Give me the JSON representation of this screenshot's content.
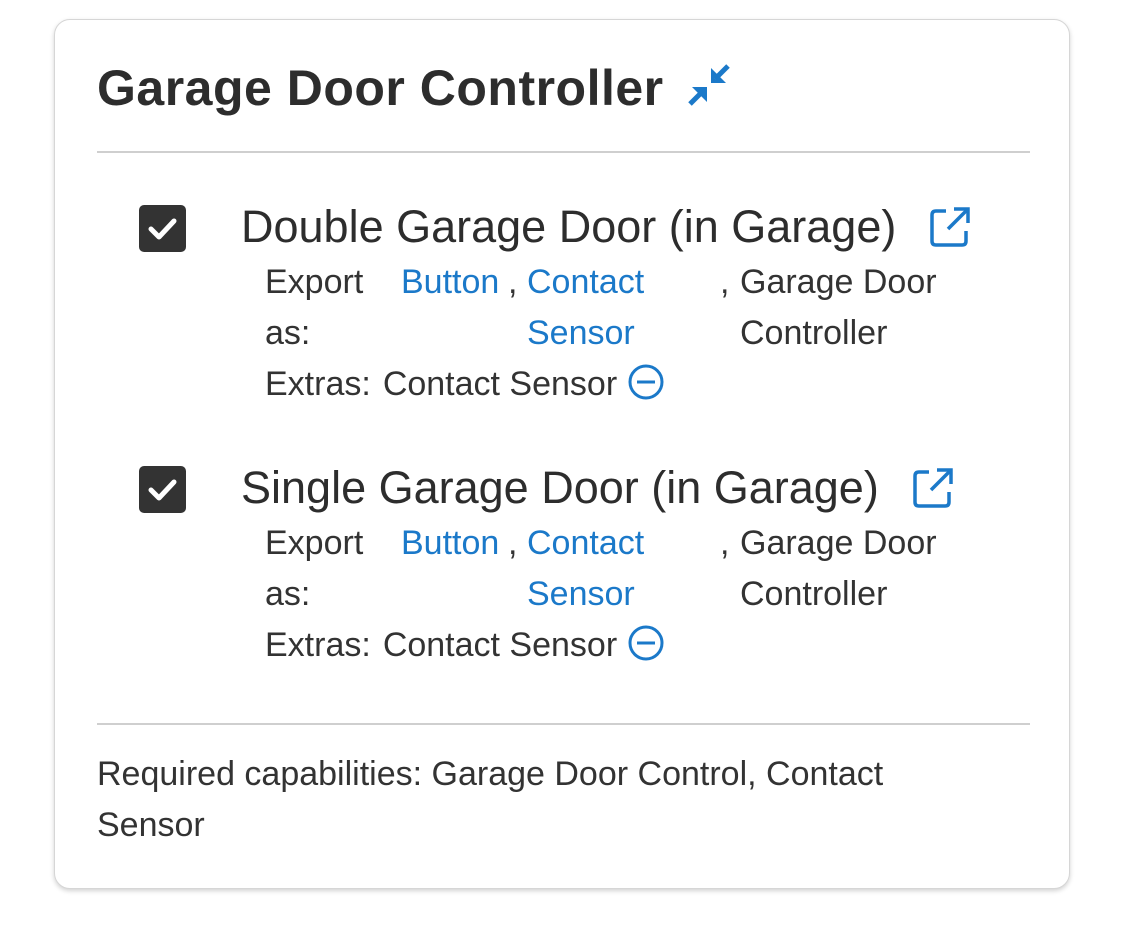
{
  "card": {
    "title": "Garage Door Controller",
    "header_icon": "collapse-arrows-icon",
    "accent_color": "#1b79c9"
  },
  "devices": [
    {
      "name": "Double Garage Door (in Garage)",
      "checked": true,
      "export_label": "Export as:",
      "export_links": [
        "Button",
        "Contact Sensor"
      ],
      "export_plain": "Garage Door Controller",
      "comma": ",",
      "extras_label": "Extras:",
      "extras_value": "Contact Sensor",
      "icons": [
        "checkbox-checked-icon",
        "open-external-icon",
        "remove-circle-icon"
      ]
    },
    {
      "name": "Single Garage Door (in Garage)",
      "checked": true,
      "export_label": "Export as:",
      "export_links": [
        "Button",
        "Contact Sensor"
      ],
      "export_plain": "Garage Door Controller",
      "comma": ",",
      "extras_label": "Extras:",
      "extras_value": "Contact Sensor",
      "icons": [
        "checkbox-checked-icon",
        "open-external-icon",
        "remove-circle-icon"
      ]
    }
  ],
  "footer": {
    "required_capabilities": "Required capabilities: Garage Door Control, Contact Sensor"
  }
}
